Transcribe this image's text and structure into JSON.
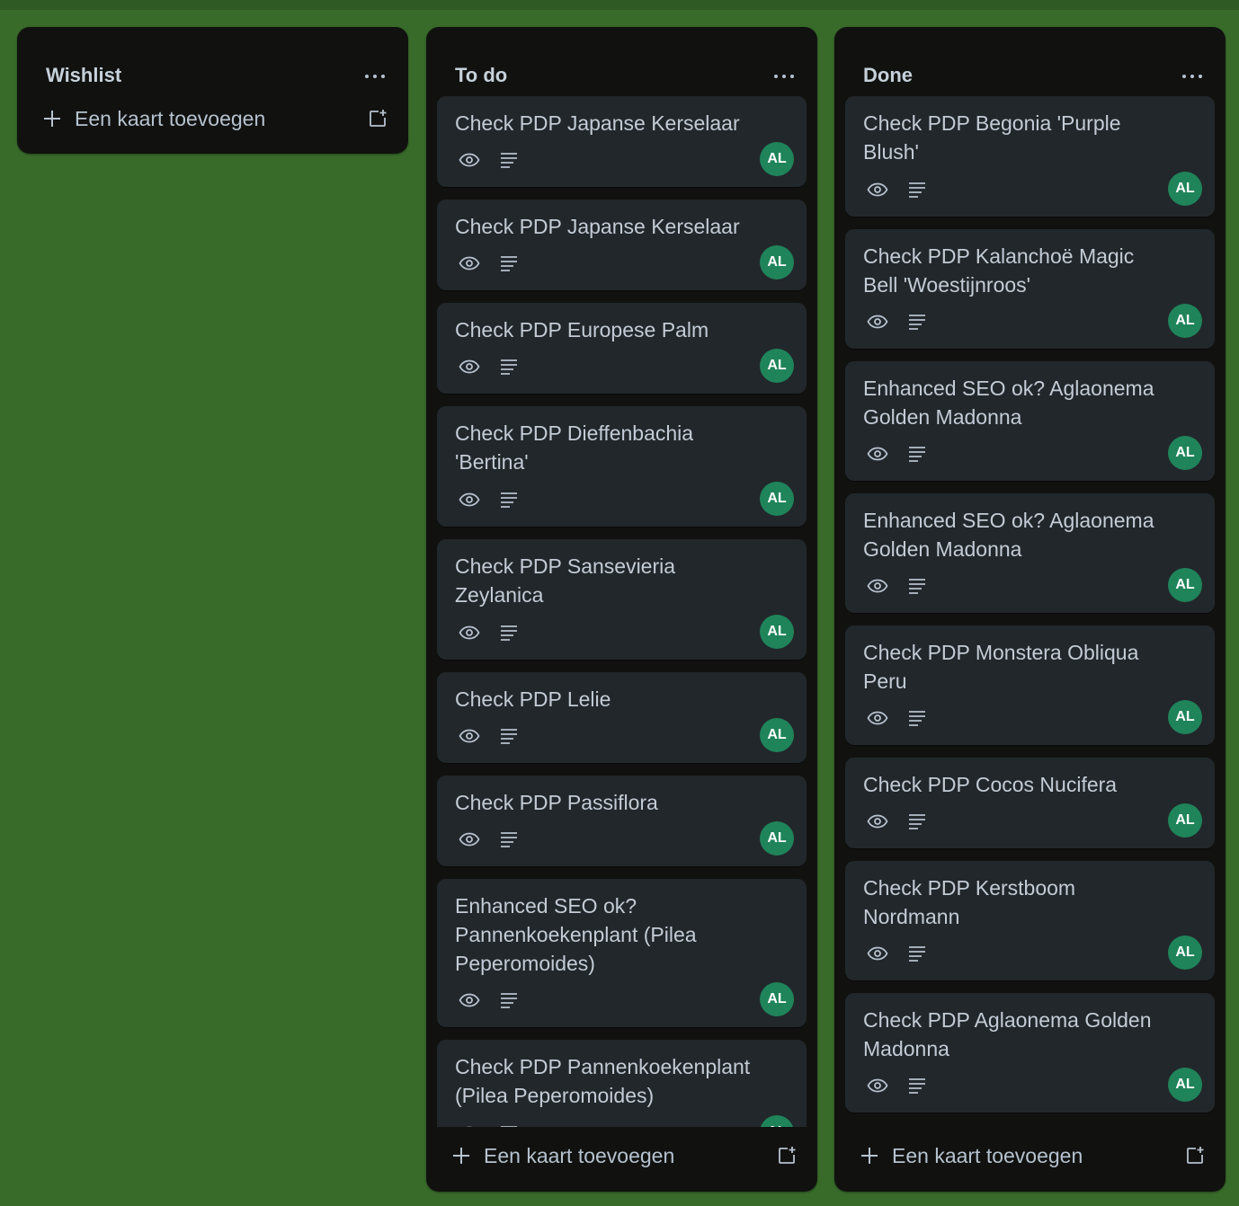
{
  "board": {
    "lists": [
      {
        "title": "Wishlist",
        "add_card_label": "Een kaart toevoegen",
        "cards": []
      },
      {
        "title": "To do",
        "add_card_label": "Een kaart toevoegen",
        "cards": [
          {
            "title": "Check PDP Japanse Kerselaar",
            "member": "AL"
          },
          {
            "title": "Check PDP Japanse Kerselaar",
            "member": "AL"
          },
          {
            "title": "Check PDP Europese Palm",
            "member": "AL"
          },
          {
            "title": "Check PDP Dieffenbachia 'Bertina'",
            "member": "AL"
          },
          {
            "title": "Check PDP Sansevieria Zeylanica",
            "member": "AL"
          },
          {
            "title": "Check PDP Lelie",
            "member": "AL"
          },
          {
            "title": "Check PDP Passiflora",
            "member": "AL"
          },
          {
            "title": "Enhanced SEO ok? Pannenkoekenplant (Pilea Peperomoides)",
            "member": "AL"
          },
          {
            "title": "Check PDP Pannenkoekenplant (Pilea Peperomoides)",
            "member": "AL"
          }
        ]
      },
      {
        "title": "Done",
        "add_card_label": "Een kaart toevoegen",
        "cards": [
          {
            "title": "Check PDP Begonia 'Purple Blush'",
            "member": "AL"
          },
          {
            "title": "Check PDP Kalanchoë Magic Bell 'Woestijnroos'",
            "member": "AL"
          },
          {
            "title": "Enhanced SEO ok? Aglaonema Golden Madonna",
            "member": "AL"
          },
          {
            "title": "Enhanced SEO ok? Aglaonema Golden Madonna",
            "member": "AL"
          },
          {
            "title": "Check PDP Monstera Obliqua Peru",
            "member": "AL"
          },
          {
            "title": "Check PDP Cocos Nucifera",
            "member": "AL"
          },
          {
            "title": "Check PDP Kerstboom Nordmann",
            "member": "AL"
          },
          {
            "title": "Check PDP Aglaonema Golden Madonna",
            "member": "AL"
          }
        ]
      }
    ]
  },
  "colors": {
    "board_background": "#386b2a",
    "list_background": "#111210",
    "card_background": "#22272b",
    "avatar_background": "#1f845a"
  },
  "icons": {
    "list_menu": "more-icon",
    "card_watch": "eye-icon",
    "card_description": "description-icon",
    "add": "plus-icon",
    "template": "template-icon"
  }
}
